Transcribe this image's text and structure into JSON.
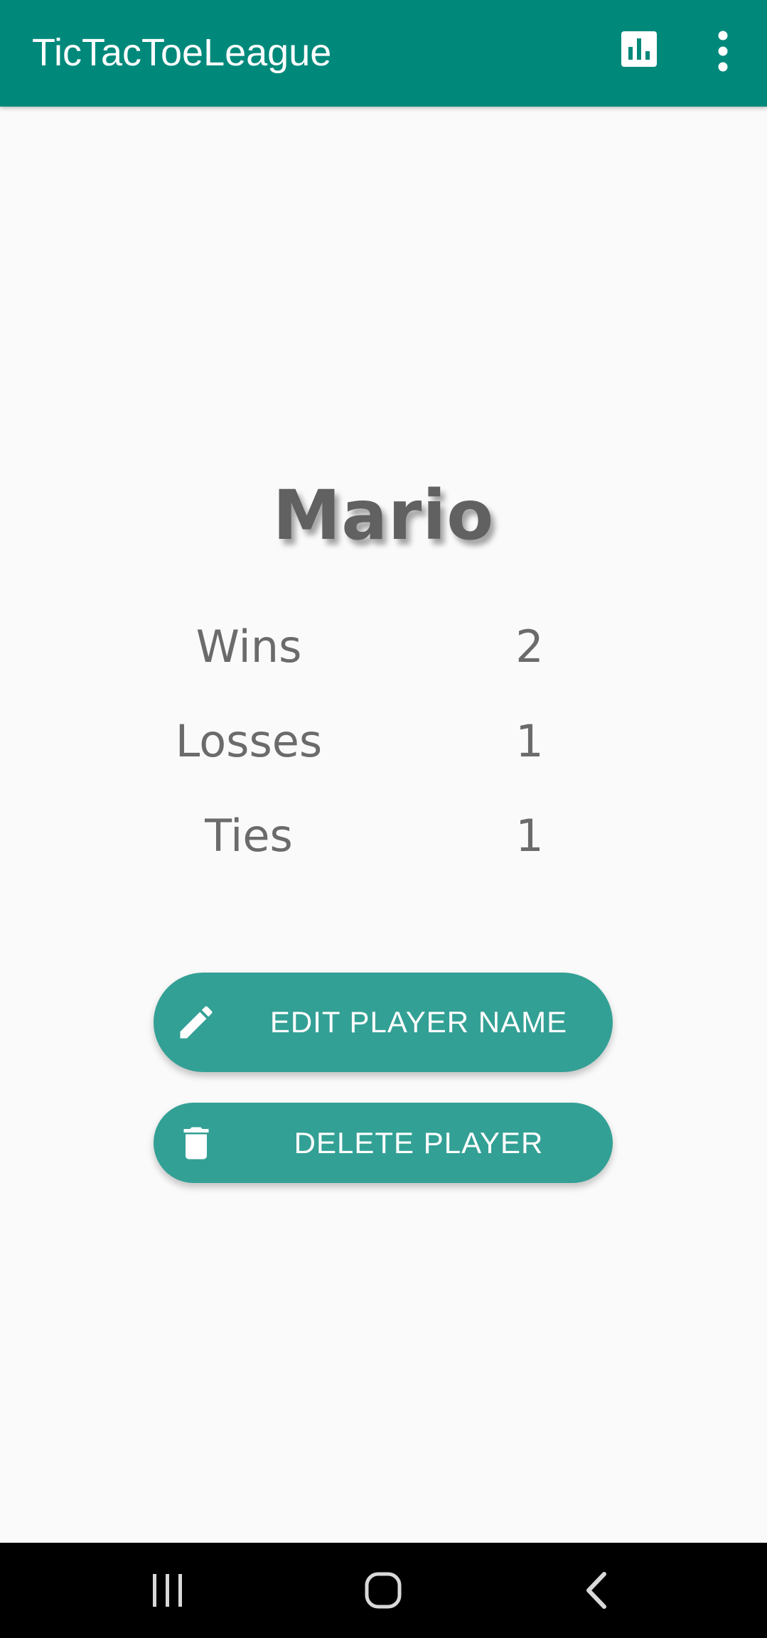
{
  "app": {
    "title": "TicTacToeLeague",
    "accent_color": "#00897b",
    "button_color": "#33a095"
  },
  "toolbar": {
    "actions": [
      {
        "icon": "bar-chart-icon"
      },
      {
        "icon": "more-vert-icon"
      }
    ]
  },
  "player": {
    "name": "Mario",
    "stats": [
      {
        "label": "Wins",
        "value": "2"
      },
      {
        "label": "Losses",
        "value": "1"
      },
      {
        "label": "Ties",
        "value": "1"
      }
    ]
  },
  "buttons": {
    "edit": {
      "label": "EDIT PLAYER NAME",
      "icon": "pencil-icon"
    },
    "delete": {
      "label": "DELETE PLAYER",
      "icon": "trash-icon"
    }
  },
  "navbar": {
    "items": [
      {
        "icon": "recent-apps-icon"
      },
      {
        "icon": "home-icon"
      },
      {
        "icon": "back-icon"
      }
    ]
  }
}
